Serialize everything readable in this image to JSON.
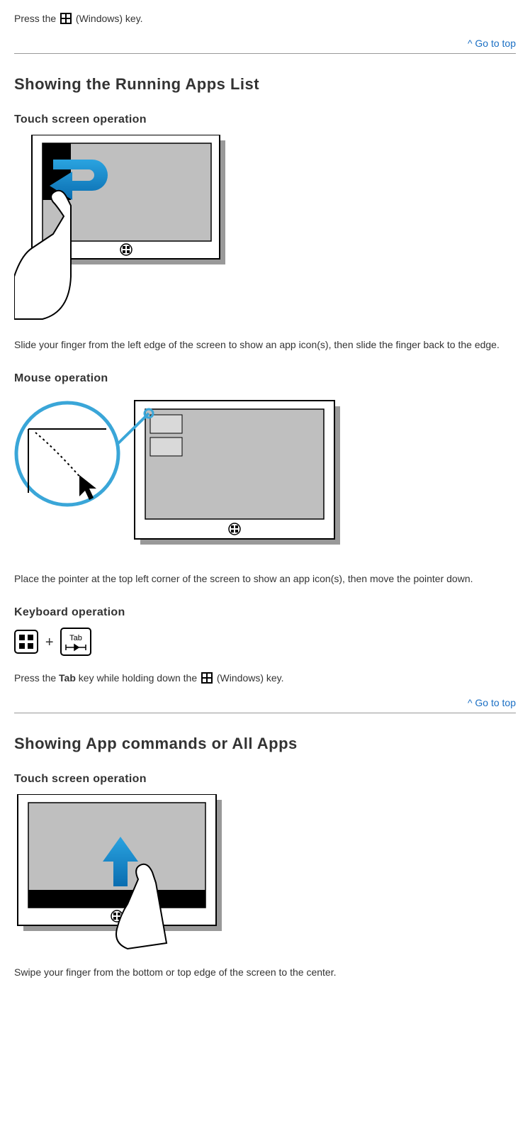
{
  "intro": {
    "press_the": "Press the ",
    "windows_key": " (Windows) key."
  },
  "go_to_top": "^ Go to top",
  "section1": {
    "title": "Showing the Running Apps List",
    "touch_heading": "Touch screen operation",
    "touch_text": "Slide your finger from the left edge of the screen to show an app icon(s), then slide the finger back to the edge.",
    "mouse_heading": "Mouse operation",
    "mouse_text": "Place the pointer at the top left corner of the screen to show an app icon(s), then move the pointer down.",
    "keyboard_heading": "Keyboard operation",
    "keyboard_press": "Press the ",
    "keyboard_tab": "Tab",
    "keyboard_hold": " key while holding down the ",
    "keyboard_windows": " (Windows) key.",
    "tab_label": "Tab"
  },
  "section2": {
    "title": "Showing App commands or All Apps",
    "touch_heading": "Touch screen operation",
    "touch_text": "Swipe your finger from the bottom or top edge of the screen to the center."
  }
}
